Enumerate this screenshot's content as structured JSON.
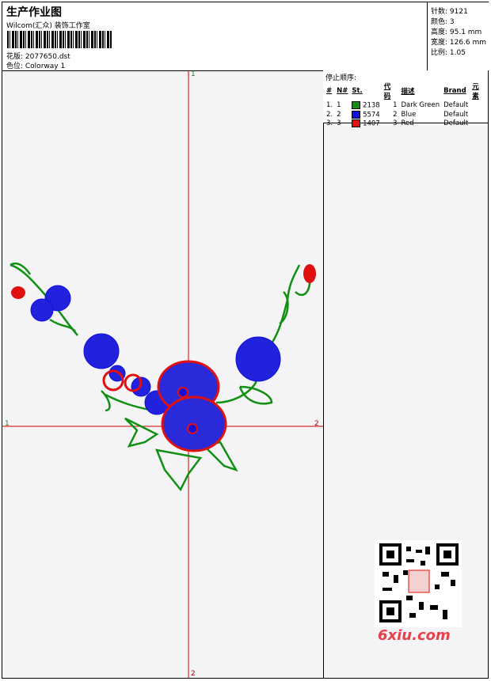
{
  "header": {
    "title": "生产作业图",
    "studio": "Wilcom(汇众) 装饰工作室",
    "design_label": "花版: 2077650.dst",
    "colorway_label": "色位: Colorway 1"
  },
  "stats": {
    "stitches": "针数: 9121",
    "colors": "颜色: 3",
    "height": "高度: 95.1 mm",
    "width": "宽度: 126.6 mm",
    "scale": "比例: 1.05"
  },
  "stop_sequence": {
    "heading": "停止顺序:",
    "columns": [
      "#",
      "N#",
      "St.",
      "代码",
      "描述",
      "Brand",
      "元素"
    ],
    "rows": [
      {
        "idx": "1.",
        "n": "1",
        "color": "#109010",
        "st": "2138",
        "code": "1",
        "desc": "Dark Green",
        "brand": "Default"
      },
      {
        "idx": "2.",
        "n": "2",
        "color": "#1010e0",
        "st": "5574",
        "code": "2",
        "desc": "Blue",
        "brand": "Default"
      },
      {
        "idx": "3.",
        "n": "3",
        "color": "#e01010",
        "st": "1407",
        "code": "3",
        "desc": "Red",
        "brand": "Default"
      }
    ]
  },
  "axes": {
    "top": "1",
    "bottom": "2",
    "left": "1",
    "right": "2"
  },
  "watermark": "6xiu.com",
  "colors": {
    "green": "#109010",
    "blue": "#1010e0",
    "red": "#e01010",
    "axis": "#d00000"
  }
}
